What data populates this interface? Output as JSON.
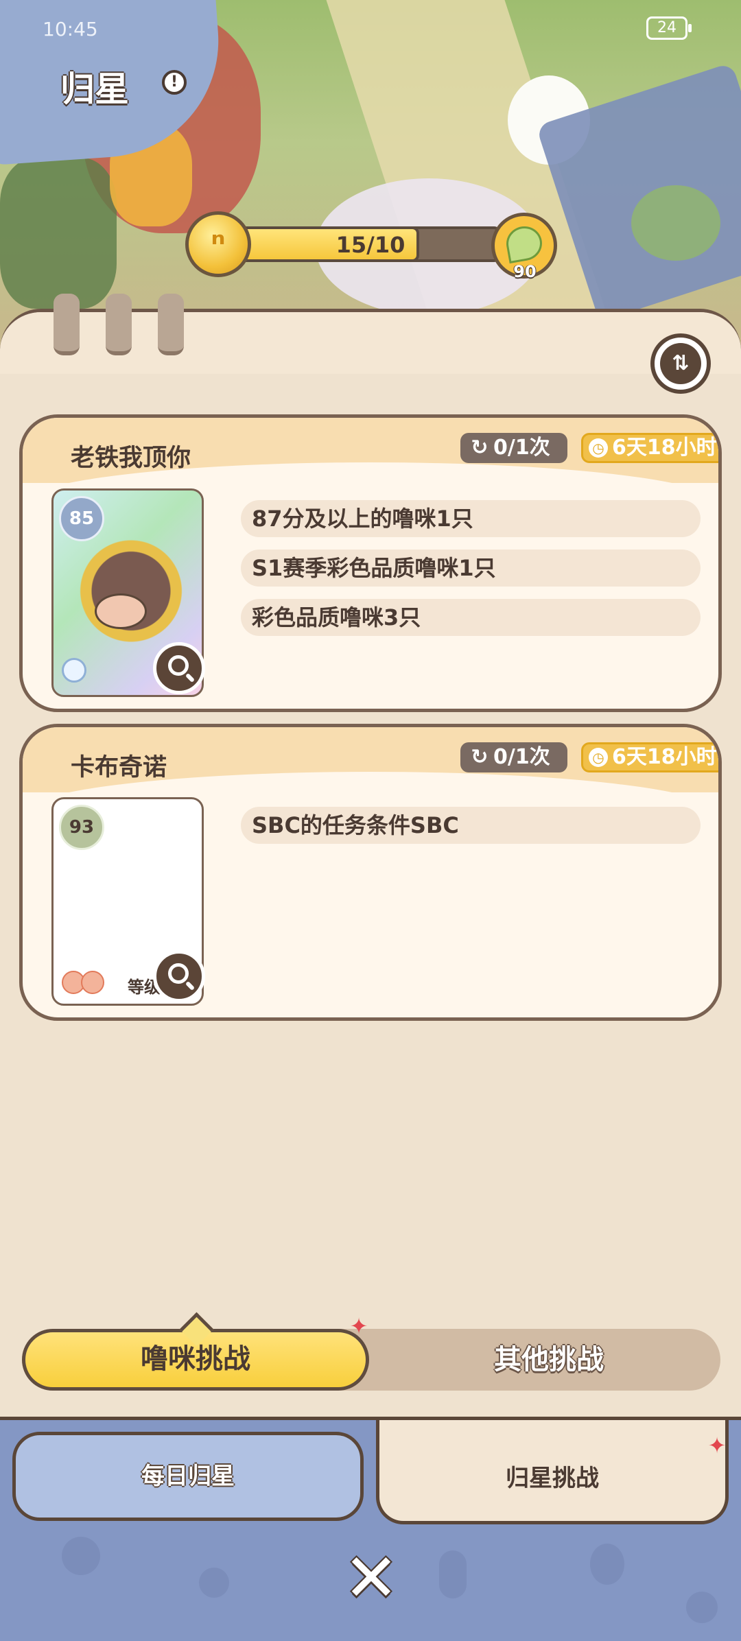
{
  "status_bar": {
    "time": "10:45",
    "battery": "24"
  },
  "header": {
    "title": "归星"
  },
  "progress": {
    "icon_glyph": "ⁿ",
    "current": 15,
    "max": 10,
    "text": "15/10",
    "reward_count": "90"
  },
  "cards": [
    {
      "title": "老铁我顶你",
      "attempts": "0/1次",
      "time_left": "6天18小时",
      "score": "85",
      "requirements": [
        "87分及以上的噜咪1只",
        "S1赛季彩色品质噜咪1只",
        "彩色品质噜咪3只"
      ]
    },
    {
      "title": "卡布奇诺",
      "attempts": "0/1次",
      "time_left": "6天18小时",
      "score": "93",
      "thumb_caption": "等级",
      "requirements": [
        "SBC的任务条件SBC"
      ]
    }
  ],
  "challenge_tabs": {
    "active": "噜咪挑战",
    "other": "其他挑战"
  },
  "bottom_tabs": {
    "left": "每日归星",
    "right": "归星挑战"
  },
  "colors": {
    "accent_yellow": "#f8cf3c",
    "panel": "#efe2cf",
    "nav_blue": "#8497c4",
    "dark_brown": "#5a4638"
  }
}
